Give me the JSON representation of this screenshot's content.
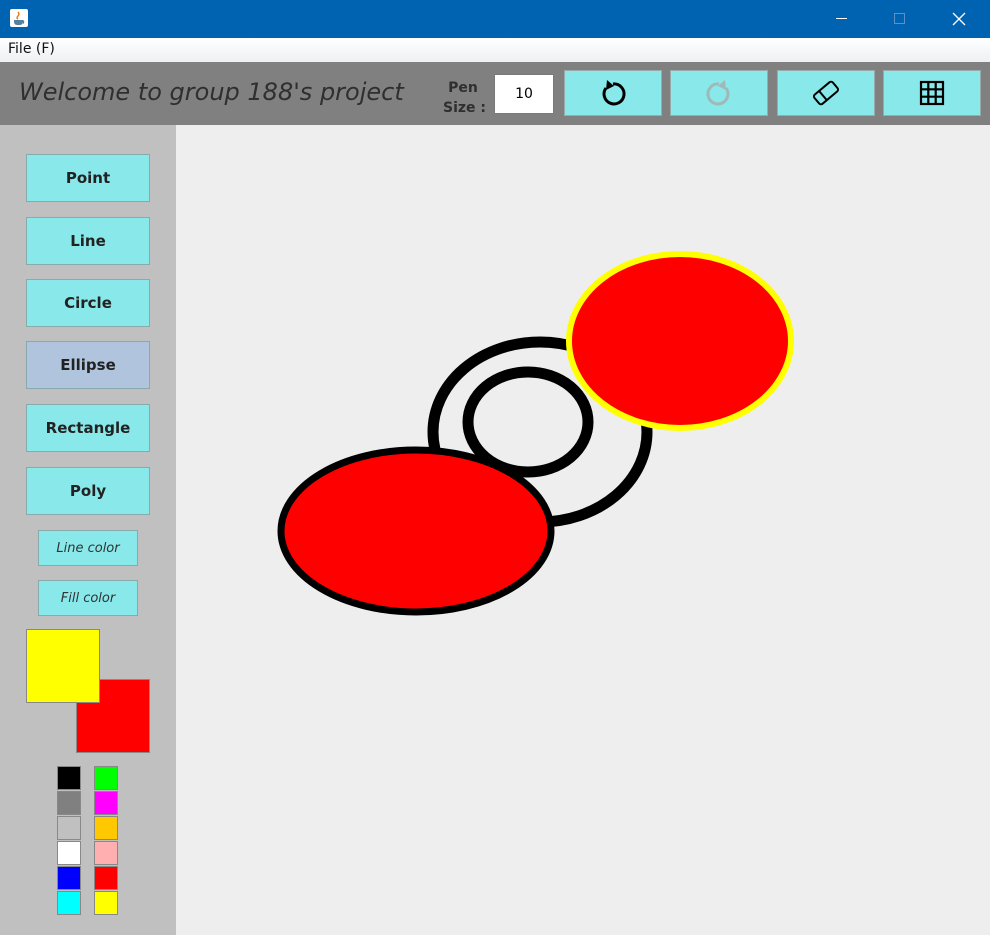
{
  "menu": {
    "file_label": "File (F)"
  },
  "header": {
    "welcome_text": "Welcome to group 188's project",
    "pen_size_label_line1": "Pen",
    "pen_size_label_line2": "Size :",
    "pen_size_value": "10"
  },
  "toolbar": {
    "buttons": [
      {
        "name": "undo",
        "icon": "undo-icon",
        "enabled": true
      },
      {
        "name": "redo",
        "icon": "redo-icon",
        "enabled": false
      },
      {
        "name": "eraser",
        "icon": "eraser-icon",
        "enabled": true
      },
      {
        "name": "grid",
        "icon": "grid-icon",
        "enabled": true
      }
    ]
  },
  "shapes": {
    "point": "Point",
    "line": "Line",
    "circle": "Circle",
    "ellipse": "Ellipse",
    "rectangle": "Rectangle",
    "poly": "Poly",
    "selected": "Ellipse"
  },
  "colors": {
    "line_color_label": "Line color",
    "fill_color_label": "Fill color",
    "current_line_color": "#ffff00",
    "current_fill_color": "#ff0000",
    "palette_left": [
      "#000000",
      "#808080",
      "#c0c0c0",
      "#ffffff",
      "#0000ff",
      "#00ffff"
    ],
    "palette_right": [
      "#00ff00",
      "#ff00ff",
      "#ffc800",
      "#ffafaf",
      "#ff0000",
      "#ffff00"
    ]
  },
  "theme": {
    "button_bg": "#88e8ea",
    "selected_bg": "#b0c4de",
    "titlebar": "#0063b1"
  }
}
